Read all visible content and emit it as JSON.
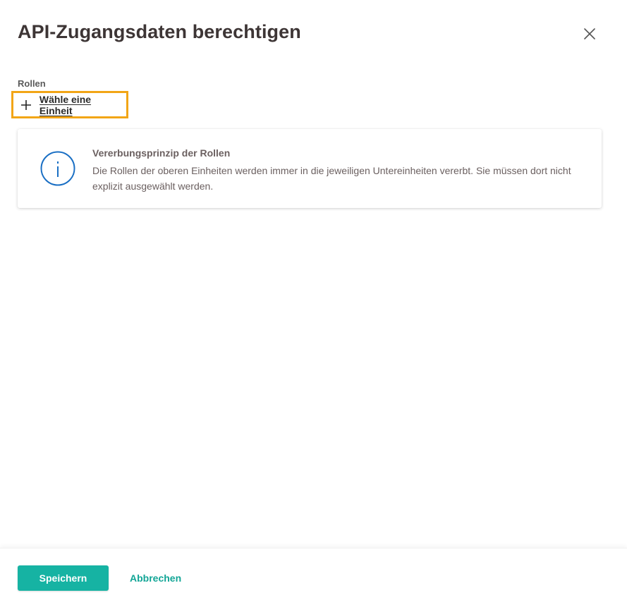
{
  "dialog": {
    "title": "API-Zugangsdaten berechtigen",
    "close_icon": "close-icon"
  },
  "roles": {
    "label": "Rollen",
    "add_unit_label": "Wähle eine Einheit",
    "add_icon": "plus-icon"
  },
  "info": {
    "icon": "info-icon",
    "heading": "Vererbungsprinzip der Rollen",
    "body": "Die Rollen der oberen Einheiten werden immer in die jeweiligen Untereinheiten vererbt. Sie müssen dort nicht explizit ausgewählt werden."
  },
  "footer": {
    "save_label": "Speichern",
    "cancel_label": "Abbrechen"
  },
  "colors": {
    "primary": "#16b3a3",
    "focus_outline": "#f2a516",
    "info_blue": "#1a6fc4",
    "title_text": "#3d3535"
  }
}
